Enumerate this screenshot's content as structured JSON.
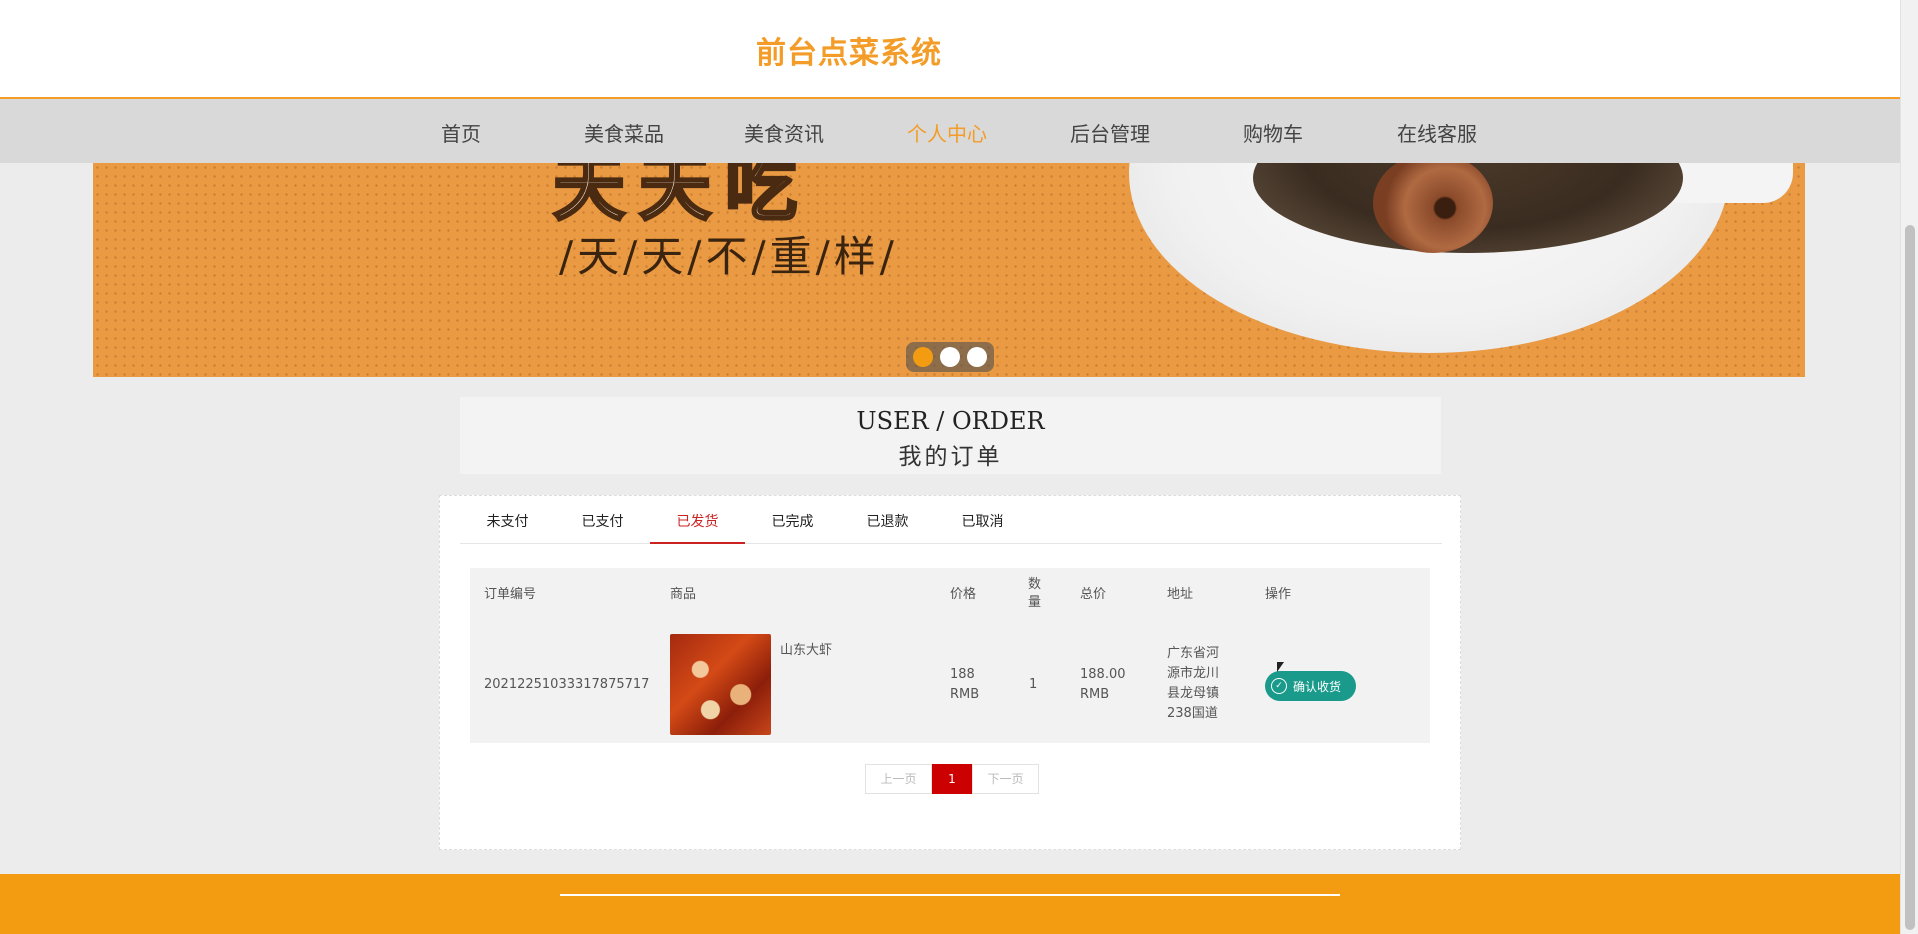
{
  "header": {
    "title": "前台点菜系统"
  },
  "nav": {
    "items": [
      {
        "label": "首页"
      },
      {
        "label": "美食菜品"
      },
      {
        "label": "美食资讯"
      },
      {
        "label": "个人中心"
      },
      {
        "label": "后台管理"
      },
      {
        "label": "购物车"
      },
      {
        "label": "在线客服"
      }
    ],
    "active_index": 3,
    "active_color": "#f39c27"
  },
  "banner": {
    "slogan": "/天/天/不/重/样/",
    "slide_count": 3,
    "active_slide": 1
  },
  "section": {
    "title_en": "USER / ORDER",
    "title_zh": "我的订单"
  },
  "tabs": {
    "items": [
      {
        "label": "未支付"
      },
      {
        "label": "已支付"
      },
      {
        "label": "已发货"
      },
      {
        "label": "已完成"
      },
      {
        "label": "已退款"
      },
      {
        "label": "已取消"
      }
    ],
    "active_index": 2
  },
  "table": {
    "headers": {
      "order_no": "订单编号",
      "product": "商品",
      "price": "价格",
      "qty": "数量",
      "total": "总价",
      "address": "地址",
      "action": "操作"
    },
    "rows": [
      {
        "order_no": "20212251033317875717",
        "product_name": "山东大虾",
        "price": "188 RMB",
        "qty": "1",
        "total": "188.00 RMB",
        "address": "广东省河源市龙川县龙母镇238国道",
        "action_label": "确认收货"
      }
    ]
  },
  "pagination": {
    "prev": "上一页",
    "current": "1",
    "next": "下一页"
  },
  "colors": {
    "brand": "#f39c27",
    "footer": "#f39c12",
    "tab_active": "#cc2222",
    "action_button": "#1a9a8a",
    "page_current": "#cc0000"
  }
}
